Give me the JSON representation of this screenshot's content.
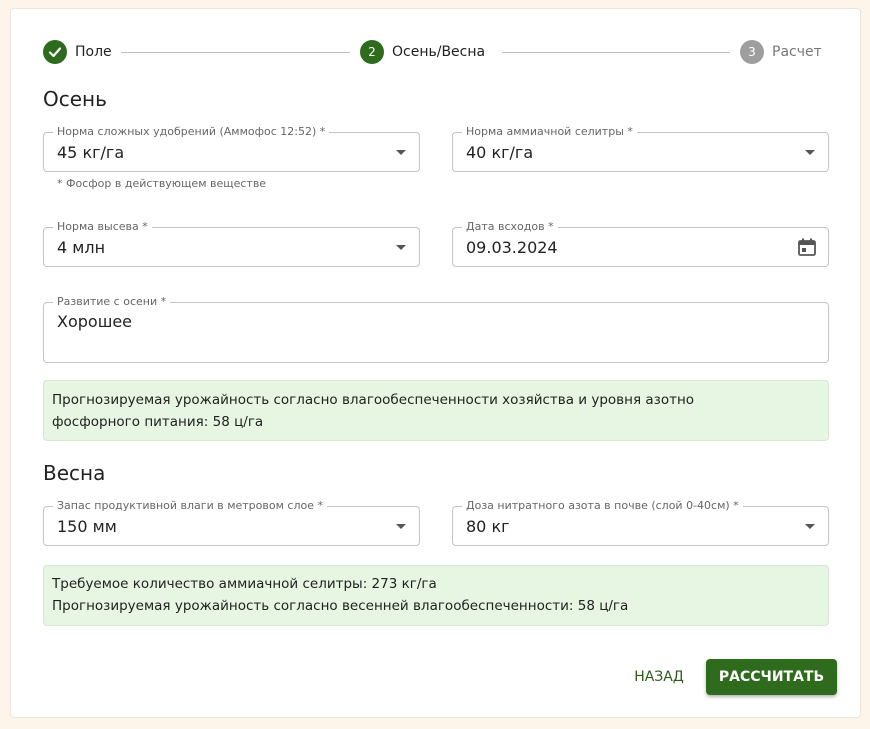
{
  "stepper": {
    "steps": [
      {
        "number": "✓",
        "label": "Поле",
        "state": "completed"
      },
      {
        "number": "2",
        "label": "Осень/Весна",
        "state": "active"
      },
      {
        "number": "3",
        "label": "Расчет",
        "state": "inactive"
      }
    ]
  },
  "colors": {
    "primary": "#2e6b1c",
    "step_inactive": "#9e9e9e",
    "alert_bg": "#e6f6e3"
  },
  "autumn": {
    "title": "Осень",
    "complex_fertilizer": {
      "label": "Норма сложных удобрений (Аммофос 12:52) *",
      "value": "45 кг/га",
      "helper": "* Фосфор в действующем веществе"
    },
    "ammonium_nitrate": {
      "label": "Норма аммиачной селитры *",
      "value": "40 кг/га"
    },
    "seeding_rate": {
      "label": "Норма высева *",
      "value": "4 млн"
    },
    "emergence_date": {
      "label": "Дата всходов *",
      "value": "09.03.2024"
    },
    "autumn_development": {
      "label": "Развитие с осени *",
      "value": "Хорошее"
    },
    "forecast": {
      "line1": "Прогнозируемая урожайность согласно влагообеспеченности хозяйства и уровня азотно",
      "line2": "фосфорного питания: 58 ц/га"
    }
  },
  "spring": {
    "title": "Весна",
    "soil_moisture": {
      "label": "Запас продуктивной влаги в метровом слое *",
      "value": "150 мм"
    },
    "nitrate_nitrogen": {
      "label": "Доза нитратного азота в почве (слой 0-40см) *",
      "value": "80 кг"
    },
    "result": {
      "line1": "Требуемое количество аммиачной селитры: 273 кг/га",
      "line2": "Прогнозируемая урожайность согласно весенней влагообеспеченности: 58 ц/га"
    }
  },
  "actions": {
    "back_label": "НАЗАД",
    "calculate_label": "РАССЧИТАТЬ"
  }
}
